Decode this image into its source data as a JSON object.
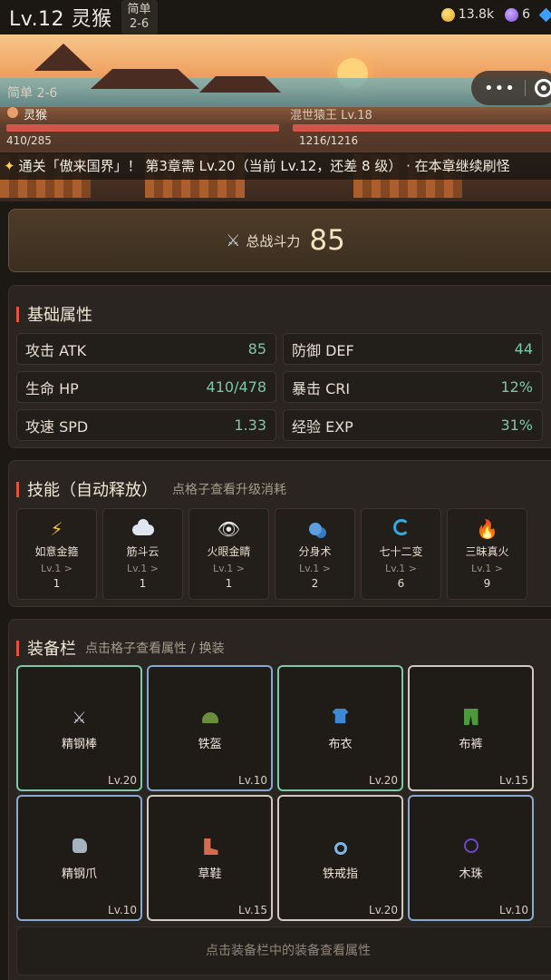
{
  "header": {
    "level_title": "Lv.12 灵猴",
    "difficulty_label": "简单",
    "difficulty_stage": "2-6",
    "coins": "13.8k",
    "gems": "6"
  },
  "battle": {
    "stage": "简单 2-6",
    "hero_name": "灵猴",
    "hero_hp": "410/285",
    "boss_name": "混世猿王 Lv.18",
    "boss_hp": "1216/1216",
    "hero_hp_fraction": 0.99,
    "boss_hp_fraction": 1.0,
    "ticker": "通关「傲来国界」！ 第3章需 Lv.20（当前 Lv.12，还差 8 级） · 在本章继续刷怪",
    "capsule_dots": "•••"
  },
  "power": {
    "label": "总战斗力",
    "value": "85"
  },
  "attributes": {
    "title": "基础属性",
    "items": [
      {
        "label": "攻击 ATK",
        "value": "85"
      },
      {
        "label": "防御 DEF",
        "value": "44"
      },
      {
        "label": "生命 HP",
        "value": "410/478"
      },
      {
        "label": "暴击 CRI",
        "value": "12%"
      },
      {
        "label": "攻速 SPD",
        "value": "1.33"
      },
      {
        "label": "经验 EXP",
        "value": "31%"
      }
    ]
  },
  "skills": {
    "title": "技能（自动释放）",
    "hint": "点格子查看升级消耗",
    "items": [
      {
        "name": "如意金箍",
        "level": "Lv.1 >",
        "count": "1",
        "icon": "lightning-icon"
      },
      {
        "name": "筋斗云",
        "level": "Lv.1 >",
        "count": "1",
        "icon": "cloud-icon"
      },
      {
        "name": "火眼金睛",
        "level": "Lv.1 >",
        "count": "1",
        "icon": "eye-icon"
      },
      {
        "name": "分身术",
        "level": "Lv.1 >",
        "count": "2",
        "icon": "clone-icon"
      },
      {
        "name": "七十二变",
        "level": "Lv.1 >",
        "count": "6",
        "icon": "spiral-icon"
      },
      {
        "name": "三昧真火",
        "level": "Lv.1 >",
        "count": "9",
        "icon": "fire-icon"
      }
    ]
  },
  "equipment": {
    "title": "装备栏",
    "hint": "点击格子查看属性 / 换装",
    "items": [
      {
        "name": "精钢棒",
        "level": "Lv.20",
        "rarity": "green",
        "icon": "crossed-swords-icon"
      },
      {
        "name": "铁盔",
        "level": "Lv.10",
        "rarity": "blue",
        "icon": "helmet-icon"
      },
      {
        "name": "布衣",
        "level": "Lv.20",
        "rarity": "green",
        "icon": "shirt-icon"
      },
      {
        "name": "布裤",
        "level": "Lv.15",
        "rarity": "white",
        "icon": "pants-icon"
      },
      {
        "name": "精钢爪",
        "level": "Lv.10",
        "rarity": "blue",
        "icon": "glove-icon"
      },
      {
        "name": "草鞋",
        "level": "Lv.15",
        "rarity": "white",
        "icon": "boot-icon"
      },
      {
        "name": "铁戒指",
        "level": "Lv.20",
        "rarity": "white",
        "icon": "ring-icon"
      },
      {
        "name": "木珠",
        "level": "Lv.10",
        "rarity": "blue",
        "icon": "bead-icon"
      }
    ],
    "footer_hint": "点击装备栏中的装备查看属性"
  },
  "colors": {
    "accent_red": "#e0553c",
    "stat_value": "#7ec7a6",
    "rarity_green": "#7fc9a8",
    "rarity_blue": "#86a8d2",
    "rarity_white": "#cfc9bf"
  }
}
